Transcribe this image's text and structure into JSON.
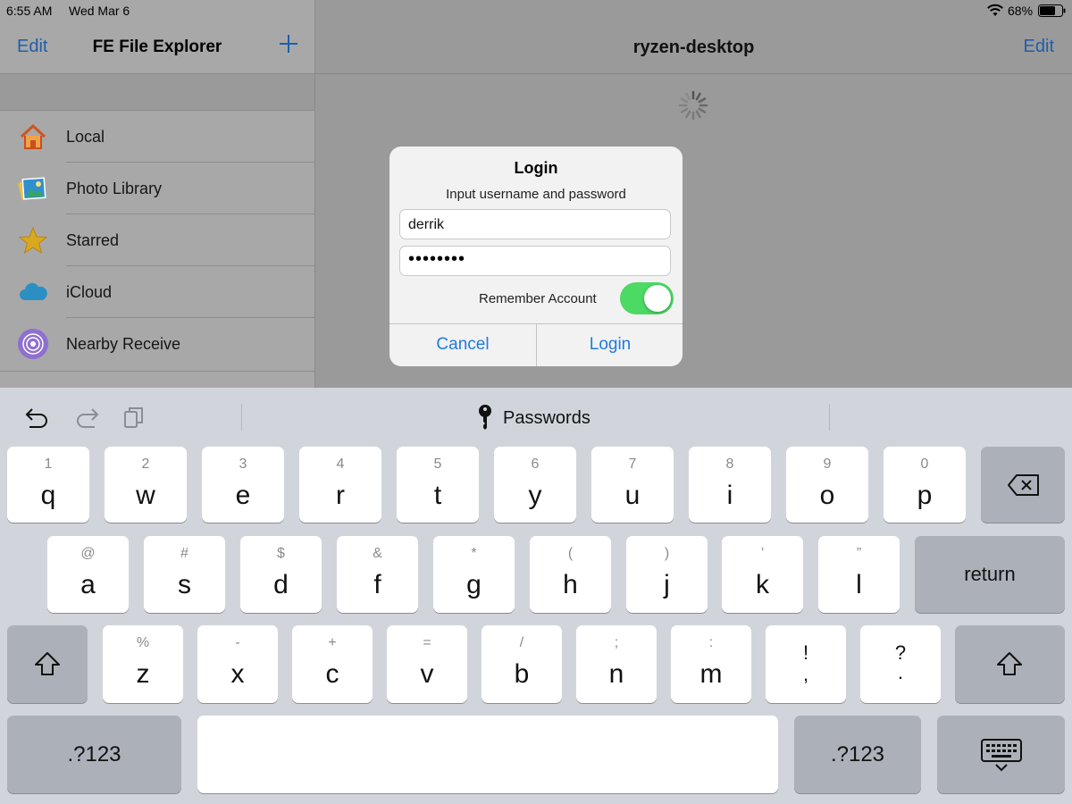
{
  "status_bar": {
    "time": "6:55 AM",
    "date": "Wed Mar 6",
    "battery": "68%"
  },
  "sidebar": {
    "edit_label": "Edit",
    "title": "FE File Explorer",
    "items": [
      {
        "label": "Local",
        "icon": "home-icon"
      },
      {
        "label": "Photo Library",
        "icon": "photo-library-icon"
      },
      {
        "label": "Starred",
        "icon": "star-icon"
      },
      {
        "label": "iCloud",
        "icon": "cloud-icon"
      },
      {
        "label": "Nearby Receive",
        "icon": "nearby-receive-icon"
      }
    ]
  },
  "detail": {
    "title": "ryzen-desktop",
    "edit_label": "Edit"
  },
  "dialog": {
    "title": "Login",
    "message": "Input username and password",
    "username": "derrik",
    "password_mask": "••••••••",
    "remember_label": "Remember Account",
    "remember_on": true,
    "cancel_label": "Cancel",
    "login_label": "Login"
  },
  "keyboard": {
    "passwords_label": "Passwords",
    "row1": [
      {
        "top": "1",
        "main": "q"
      },
      {
        "top": "2",
        "main": "w"
      },
      {
        "top": "3",
        "main": "e"
      },
      {
        "top": "4",
        "main": "r"
      },
      {
        "top": "5",
        "main": "t"
      },
      {
        "top": "6",
        "main": "y"
      },
      {
        "top": "7",
        "main": "u"
      },
      {
        "top": "8",
        "main": "i"
      },
      {
        "top": "9",
        "main": "o"
      },
      {
        "top": "0",
        "main": "p"
      }
    ],
    "row2": [
      {
        "top": "@",
        "main": "a"
      },
      {
        "top": "#",
        "main": "s"
      },
      {
        "top": "$",
        "main": "d"
      },
      {
        "top": "&",
        "main": "f"
      },
      {
        "top": "*",
        "main": "g"
      },
      {
        "top": "(",
        "main": "h"
      },
      {
        "top": ")",
        "main": "j"
      },
      {
        "top": "’",
        "main": "k"
      },
      {
        "top": "”",
        "main": "l"
      }
    ],
    "row3": [
      {
        "top": "%",
        "main": "z"
      },
      {
        "top": "-",
        "main": "x"
      },
      {
        "top": "+",
        "main": "c"
      },
      {
        "top": "=",
        "main": "v"
      },
      {
        "top": "/",
        "main": "b"
      },
      {
        "top": ";",
        "main": "n"
      },
      {
        "top": ":",
        "main": "m"
      }
    ],
    "exclam": {
      "top": "!",
      "main": ","
    },
    "question": {
      "top": "?",
      "main": "."
    },
    "return_label": "return",
    "numbers_label": ".?123"
  },
  "colors": {
    "accent": "#1f7ae0",
    "toggle_on": "#4cd964",
    "key_bg": "#ffffff",
    "key_dark": "#acb1b9",
    "keyboard_bg": "#d1d5db"
  }
}
